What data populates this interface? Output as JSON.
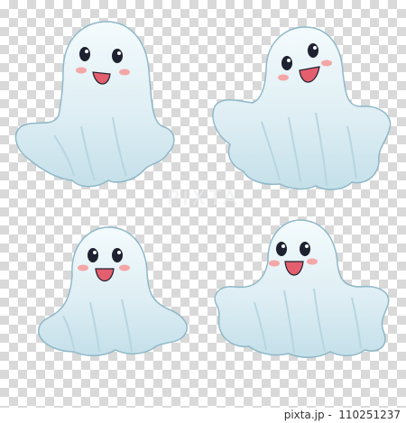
{
  "image": {
    "background": "transparency-checkerboard",
    "ghost_count": 4
  },
  "colors": {
    "ghost_body": "#e4f2f6",
    "ghost_shadow": "#b6d6e2",
    "ghost_outline": "#8fb8c8",
    "eyes": "#1d2130",
    "mouth": "#e45f6e",
    "cheeks": "#f4a7a7",
    "checker_light": "#ffffff",
    "checker_dark": "#d9d9d9"
  },
  "watermark": {
    "text": "PIXTA"
  },
  "footer": {
    "site": "pixta.jp",
    "sep": "-",
    "image_number": "110251237"
  }
}
